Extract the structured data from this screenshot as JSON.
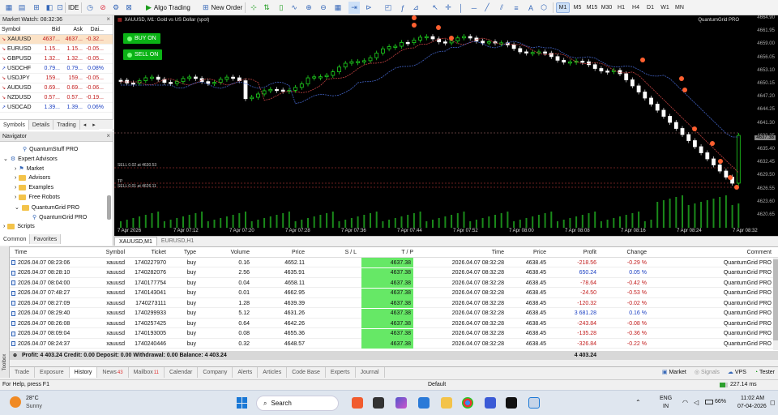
{
  "toolbar": {
    "algo_trading": "Algo Trading",
    "new_order": "New Order",
    "ide": "IDE",
    "timeframes": [
      "M1",
      "M5",
      "M15",
      "M30",
      "H1",
      "H4",
      "D1",
      "W1",
      "MN"
    ],
    "active_timeframe": "M1"
  },
  "market_watch": {
    "title": "Market Watch: 08:32:36",
    "columns": [
      "Symbol",
      "Bid",
      "Ask",
      "Dai..."
    ],
    "rows": [
      {
        "symbol": "XAUUSD",
        "bid": "4637...",
        "ask": "4637...",
        "daily": "-0.32...",
        "dir": "down"
      },
      {
        "symbol": "EURUSD",
        "bid": "1.15...",
        "ask": "1.15...",
        "daily": "-0.05...",
        "dir": "down"
      },
      {
        "symbol": "GBPUSD",
        "bid": "1.32...",
        "ask": "1.32...",
        "daily": "-0.05...",
        "dir": "down"
      },
      {
        "symbol": "USDCHF",
        "bid": "0.79...",
        "ask": "0.79...",
        "daily": "0.08%",
        "dir": "up"
      },
      {
        "symbol": "USDJPY",
        "bid": "159...",
        "ask": "159...",
        "daily": "-0.05...",
        "dir": "down"
      },
      {
        "symbol": "AUDUSD",
        "bid": "0.69...",
        "ask": "0.69...",
        "daily": "-0.06...",
        "dir": "down"
      },
      {
        "symbol": "NZDUSD",
        "bid": "0.57...",
        "ask": "0.57...",
        "daily": "-0.19...",
        "dir": "down"
      },
      {
        "symbol": "USDCAD",
        "bid": "1.39...",
        "ask": "1.39...",
        "daily": "0.06%",
        "dir": "up"
      }
    ],
    "tabs": [
      "Symbols",
      "Details",
      "Trading"
    ]
  },
  "navigator": {
    "title": "Navigator",
    "items": [
      "QuantumStuff PRO",
      "Expert Advisors",
      "Market",
      "Advisors",
      "Examples",
      "Free Robots",
      "QuantumGrid PRO",
      "QuantumGrid PRO",
      "Scripts"
    ],
    "tabs": [
      "Common",
      "Favorites"
    ]
  },
  "chart": {
    "title": "XAUUSD, M1: Gold vs US Dollar (spot)",
    "indicator": "QuantumGrid PRO",
    "buy_label": "BUY ON",
    "sell_label": "SELL ON",
    "sell_line_1": "SELL 0.02 at 4630.53",
    "tp_label": "TP",
    "sell_line_2": "SELL 0.01 at 4626.11",
    "price_labels": [
      "4664.90",
      "4661.95",
      "4659.00",
      "4656.05",
      "4653.10",
      "4650.15",
      "4647.20",
      "4644.25",
      "4641.30",
      "4638.35",
      "4635.40",
      "4632.45",
      "4629.50",
      "4626.55",
      "4623.60",
      "4620.65"
    ],
    "current_price": "4637.38",
    "time_labels": [
      "7 Apr 2026",
      "7 Apr 07:12",
      "7 Apr 07:20",
      "7 Apr 07:28",
      "7 Apr 07:36",
      "7 Apr 07:44",
      "7 Apr 07:52",
      "7 Apr 08:00",
      "7 Apr 08:08",
      "7 Apr 08:16",
      "7 Apr 08:24",
      "7 Apr 08:32"
    ]
  },
  "chart_tabs": [
    "XAUUSD,M1",
    "EURUSD,H1"
  ],
  "trades": {
    "columns": [
      "Time",
      "Symbol",
      "Ticket",
      "Type",
      "Volume",
      "Price",
      "S / L",
      "T / P",
      "Time",
      "Price",
      "Profit",
      "Change",
      "Comment"
    ],
    "rows": [
      {
        "time": "2026.04.07 08:23:06",
        "symbol": "xauusd",
        "ticket": "1740227970",
        "type": "buy",
        "volume": "0.16",
        "price": "4652.11",
        "sl": "",
        "tp": "4637.38",
        "ctime": "2026.04.07 08:32:28",
        "cprice": "4638.45",
        "profit": "-218.56",
        "change": "-0.29 %",
        "comment": "QuantumGrid PRO"
      },
      {
        "time": "2026.04.07 08:28:10",
        "symbol": "xauusd",
        "ticket": "1740282076",
        "type": "buy",
        "volume": "2.56",
        "price": "4635.91",
        "sl": "",
        "tp": "4637.38",
        "ctime": "2026.04.07 08:32:28",
        "cprice": "4638.45",
        "profit": "650.24",
        "change": "0.05 %",
        "comment": "QuantumGrid PRO"
      },
      {
        "time": "2026.04.07 08:04:00",
        "symbol": "xauusd",
        "ticket": "1740177754",
        "type": "buy",
        "volume": "0.04",
        "price": "4658.11",
        "sl": "",
        "tp": "4637.38",
        "ctime": "2026.04.07 08:32:28",
        "cprice": "4638.45",
        "profit": "-78.64",
        "change": "-0.42 %",
        "comment": "QuantumGrid PRO"
      },
      {
        "time": "2026.04.07 07:48:27",
        "symbol": "xauusd",
        "ticket": "1740143041",
        "type": "buy",
        "volume": "0.01",
        "price": "4662.95",
        "sl": "",
        "tp": "4637.38",
        "ctime": "2026.04.07 08:32:28",
        "cprice": "4638.45",
        "profit": "-24.50",
        "change": "-0.53 %",
        "comment": "QuantumGrid PRO"
      },
      {
        "time": "2026.04.07 08:27:09",
        "symbol": "xauusd",
        "ticket": "1740273111",
        "type": "buy",
        "volume": "1.28",
        "price": "4639.39",
        "sl": "",
        "tp": "4637.38",
        "ctime": "2026.04.07 08:32:28",
        "cprice": "4638.45",
        "profit": "-120.32",
        "change": "-0.02 %",
        "comment": "QuantumGrid PRO"
      },
      {
        "time": "2026.04.07 08:29:40",
        "symbol": "xauusd",
        "ticket": "1740299933",
        "type": "buy",
        "volume": "5.12",
        "price": "4631.26",
        "sl": "",
        "tp": "4637.38",
        "ctime": "2026.04.07 08:32:28",
        "cprice": "4638.45",
        "profit": "3 681.28",
        "change": "0.16 %",
        "comment": "QuantumGrid PRO"
      },
      {
        "time": "2026.04.07 08:26:08",
        "symbol": "xauusd",
        "ticket": "1740257425",
        "type": "buy",
        "volume": "0.64",
        "price": "4642.26",
        "sl": "",
        "tp": "4637.38",
        "ctime": "2026.04.07 08:32:28",
        "cprice": "4638.45",
        "profit": "-243.84",
        "change": "-0.08 %",
        "comment": "QuantumGrid PRO"
      },
      {
        "time": "2026.04.07 08:09:04",
        "symbol": "xauusd",
        "ticket": "1740193005",
        "type": "buy",
        "volume": "0.08",
        "price": "4655.36",
        "sl": "",
        "tp": "4637.38",
        "ctime": "2026.04.07 08:32:28",
        "cprice": "4638.45",
        "profit": "-135.28",
        "change": "-0.36 %",
        "comment": "QuantumGrid PRO"
      },
      {
        "time": "2026.04.07 08:24:37",
        "symbol": "xauusd",
        "ticket": "1740240446",
        "type": "buy",
        "volume": "0.32",
        "price": "4648.57",
        "sl": "",
        "tp": "4637.38",
        "ctime": "2026.04.07 08:32:28",
        "cprice": "4638.45",
        "profit": "-326.84",
        "change": "-0.22 %",
        "comment": "QuantumGrid PRO"
      }
    ],
    "summary": "Profit: 4 403.24  Credit: 0.00  Deposit: 0.00  Withdrawal: 0.00  Balance: 4 403.24",
    "summary_profit": "4 403.24"
  },
  "toolbox_label": "Toolbox",
  "bottom_tabs": [
    {
      "label": "Trade",
      "badge": ""
    },
    {
      "label": "Exposure",
      "badge": ""
    },
    {
      "label": "History",
      "badge": ""
    },
    {
      "label": "News",
      "badge": "43"
    },
    {
      "label": "Mailbox",
      "badge": "11"
    },
    {
      "label": "Calendar",
      "badge": ""
    },
    {
      "label": "Company",
      "badge": ""
    },
    {
      "label": "Alerts",
      "badge": ""
    },
    {
      "label": "Articles",
      "badge": ""
    },
    {
      "label": "Code Base",
      "badge": ""
    },
    {
      "label": "Experts",
      "badge": ""
    },
    {
      "label": "Journal",
      "badge": ""
    }
  ],
  "active_bottom_tab": "History",
  "bottom_right": {
    "market": "Market",
    "signals": "Signals",
    "vps": "VPS",
    "tester": "Tester"
  },
  "status": {
    "help": "For Help, press F1",
    "profile": "Default",
    "ping": "227.14 ms"
  },
  "taskbar": {
    "temp": "28°C",
    "weather": "Sunny",
    "search": "Search",
    "lang": "ENG",
    "region": "IN",
    "battery": "66%",
    "time": "11:02 AM",
    "date": "07-04-2026"
  },
  "colors": {
    "bull": "#1fd31f",
    "bear": "#ffffff",
    "tp": "#66e866",
    "neg": "#c21a1a",
    "pos": "#1a3fc2"
  }
}
